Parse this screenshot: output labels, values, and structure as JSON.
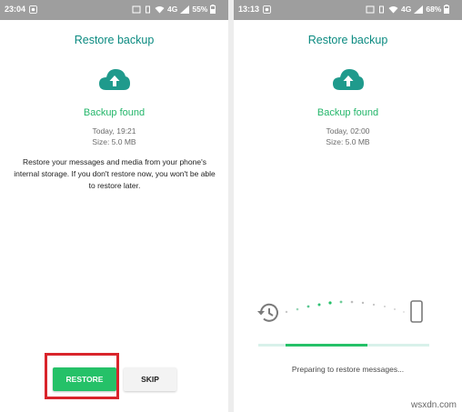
{
  "left_screen": {
    "status": {
      "time": "23:04",
      "network": "4G",
      "battery": "55%"
    },
    "title": "Restore backup",
    "backup_found": "Backup found",
    "date": "Today, 19:21",
    "size": "Size: 5.0 MB",
    "description": "Restore your messages and media from your phone's internal storage. If you don't restore now, you won't be able to restore later.",
    "restore_label": "RESTORE",
    "skip_label": "SKIP"
  },
  "right_screen": {
    "status": {
      "time": "13:13",
      "network": "4G",
      "battery": "68%"
    },
    "title": "Restore backup",
    "backup_found": "Backup found",
    "date": "Today, 02:00",
    "size": "Size: 5.0 MB",
    "progress_fraction": 0.48,
    "progress_message": "Preparing to restore messages..."
  },
  "watermark": "wsxdn.com",
  "colors": {
    "accent_teal": "#0a8a80",
    "accent_green": "#25c168",
    "highlight_red": "#d9242b",
    "status_bar": "#9e9e9e"
  },
  "icons": [
    "cloud-upload-icon",
    "history-icon",
    "phone-icon",
    "wifi-icon",
    "signal-icon",
    "battery-icon",
    "whatsapp-notification-icon"
  ]
}
